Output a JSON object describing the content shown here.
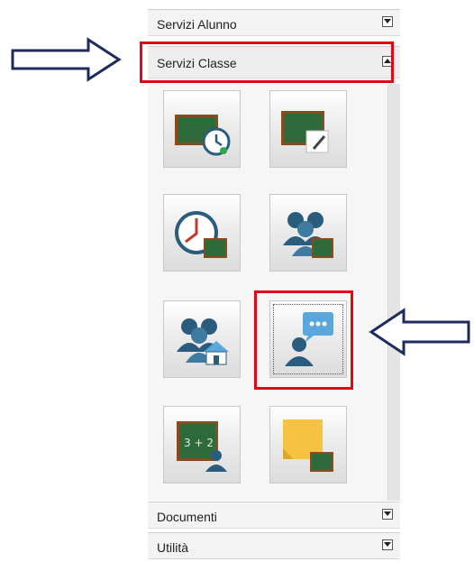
{
  "sections": {
    "servizi_alunno": "Servizi Alunno",
    "servizi_classe": "Servizi Classe",
    "documenti": "Documenti",
    "utilita": "Utilità"
  },
  "tiles": [
    {
      "icon": "blackboard-clock-icon"
    },
    {
      "icon": "blackboard-pencil-icon"
    },
    {
      "icon": "clock-blackboard-icon"
    },
    {
      "icon": "group-blackboard-icon"
    },
    {
      "icon": "group-school-icon"
    },
    {
      "icon": "user-speech-bubble-icon"
    },
    {
      "icon": "blackboard-math-user-icon"
    },
    {
      "icon": "sticky-note-blackboard-icon"
    }
  ],
  "colors": {
    "highlight": "#e30613",
    "arrow": "#1f2b5e",
    "blackboard": "#2e6b3a",
    "blackboard_frame": "#8a4b1e",
    "person": "#2a5c7e",
    "bubble": "#5aa7dd",
    "note": "#f5c242"
  }
}
